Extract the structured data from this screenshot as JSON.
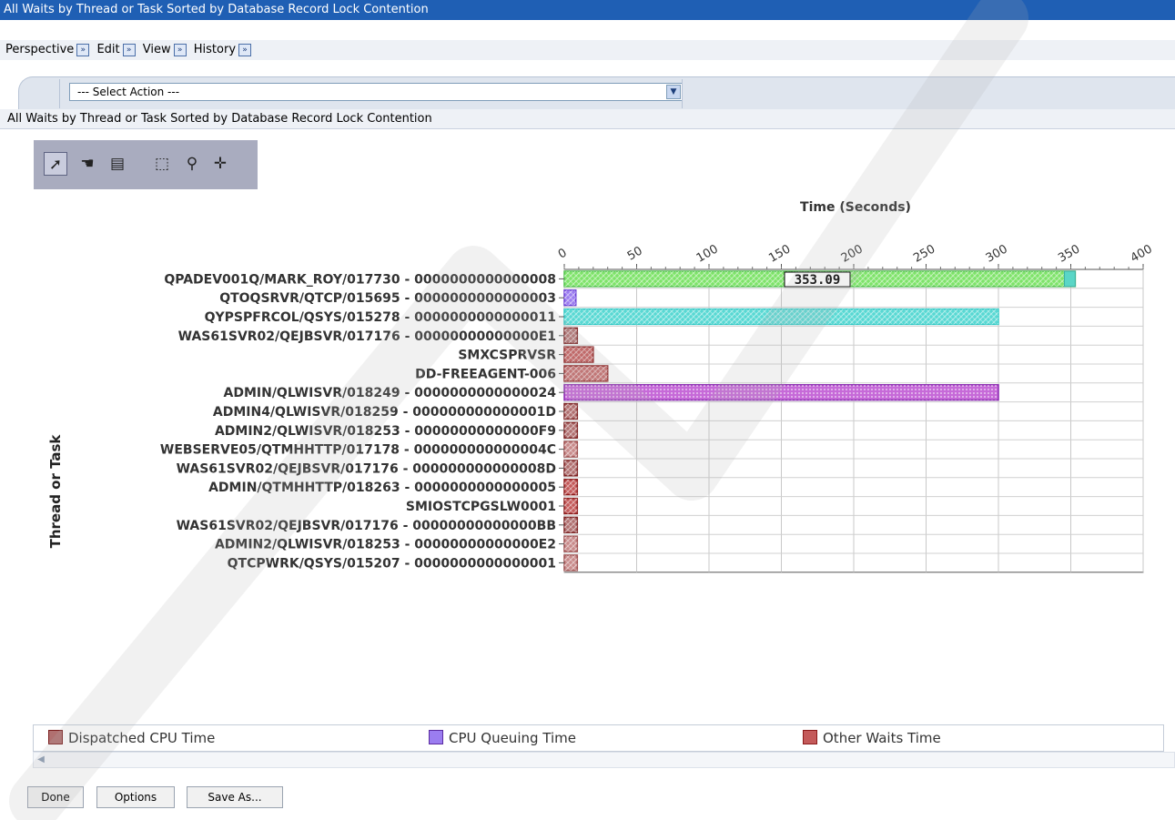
{
  "window": {
    "title": "All Waits by Thread or Task Sorted by Database Record Lock Contention"
  },
  "menu": {
    "items": [
      {
        "label": "Perspective"
      },
      {
        "label": "Edit"
      },
      {
        "label": "View"
      },
      {
        "label": "History"
      }
    ],
    "arrow_glyph": "»"
  },
  "action_select": {
    "value": "--- Select Action ---"
  },
  "panel": {
    "title": "All Waits by Thread or Task Sorted by Database Record Lock Contention"
  },
  "toolbar": {
    "tools": [
      {
        "name": "select-pointer-icon",
        "glyph": "➚",
        "active": true
      },
      {
        "name": "pan-hand-icon",
        "glyph": "☚",
        "active": false
      },
      {
        "name": "annotate-icon",
        "glyph": "▤",
        "active": false
      },
      {
        "name": "zoom-region-icon",
        "glyph": "⬚",
        "active": false
      },
      {
        "name": "zoom-out-icon",
        "glyph": "⚲",
        "active": false
      },
      {
        "name": "fit-all-icon",
        "glyph": "✛",
        "active": false
      }
    ]
  },
  "chart_data": {
    "type": "bar",
    "orientation": "horizontal",
    "xlabel": "Time (Seconds)",
    "ylabel": "Thread or Task",
    "xlim": [
      0,
      400
    ],
    "xticks": [
      0,
      50,
      100,
      150,
      200,
      250,
      300,
      350,
      400
    ],
    "grid": true,
    "categories": [
      "QPADEV001Q/MARK_ROY/017730 - 0000000000000008",
      "QTOQSRVR/QTCP/015695 - 0000000000000003",
      "QYPSPFRCOL/QSYS/015278 - 0000000000000011",
      "WAS61SVR02/QEJBSVR/017176 - 00000000000000E1",
      "SMXCSPRVSR",
      "DD-FREEAGENT-006",
      "ADMIN/QLWISVR/018249 - 0000000000000024",
      "ADMIN4/QLWISVR/018259 - 000000000000001D",
      "ADMIN2/QLWISVR/018253 - 00000000000000F9",
      "WEBSERVE05/QTMHHTTP/017178 - 000000000000004C",
      "WAS61SVR02/QEJBSVR/017176 - 000000000000008D",
      "ADMIN/QTMHHTTP/018263 - 0000000000000005",
      "SMIOSTCPGSLW0001",
      "WAS61SVR02/QEJBSVR/017176 - 00000000000000BB",
      "ADMIN2/QLWISVR/018253 - 00000000000000E2",
      "QTCPWRK/QSYS/015207 - 0000000000000001"
    ],
    "bars": [
      {
        "value": 353.09,
        "color": "#7ee36a",
        "edge": "#4fc24a",
        "tail_color": "#5ad6c6"
      },
      {
        "value": 8,
        "color": "#9b7df0",
        "edge": "#6a3fd6"
      },
      {
        "value": 300,
        "color": "#58d8d3",
        "edge": "#2ec8c4"
      },
      {
        "value": 9,
        "color": "#b07070",
        "edge": "#7a1e1e"
      },
      {
        "value": 20,
        "color": "#c45a5a",
        "edge": "#8b1a1a"
      },
      {
        "value": 30,
        "color": "#c46a6a",
        "edge": "#8b1a1a"
      },
      {
        "value": 300,
        "color": "#c66ad8",
        "edge": "#8a2ab0"
      },
      {
        "value": 9,
        "color": "#b07070",
        "edge": "#7a1e1e"
      },
      {
        "value": 9,
        "color": "#b07070",
        "edge": "#7a1e1e"
      },
      {
        "value": 9,
        "color": "#c88a8a",
        "edge": "#9a4a4a"
      },
      {
        "value": 9,
        "color": "#b07070",
        "edge": "#7a1e1e"
      },
      {
        "value": 9,
        "color": "#c45a5a",
        "edge": "#8b1a1a"
      },
      {
        "value": 9,
        "color": "#c45a5a",
        "edge": "#8b1a1a"
      },
      {
        "value": 9,
        "color": "#b07070",
        "edge": "#7a1e1e"
      },
      {
        "value": 9,
        "color": "#c88a8a",
        "edge": "#9a4a4a"
      },
      {
        "value": 9,
        "color": "#c88a8a",
        "edge": "#9a4a4a"
      }
    ],
    "tooltip": {
      "category_index": 0,
      "text": "353.09"
    },
    "legend": [
      {
        "name": "Dispatched CPU Time",
        "color": "#b07070",
        "edge": "#7a1e1e"
      },
      {
        "name": "CPU Queuing Time",
        "color": "#9b7df0",
        "edge": "#5a2aa0"
      },
      {
        "name": "Other Waits Time",
        "color": "#c45a5a",
        "edge": "#8b1a1a"
      }
    ],
    "legend_position": "bottom"
  },
  "buttons": {
    "done": "Done",
    "options": "Options",
    "save_as": "Save As..."
  }
}
